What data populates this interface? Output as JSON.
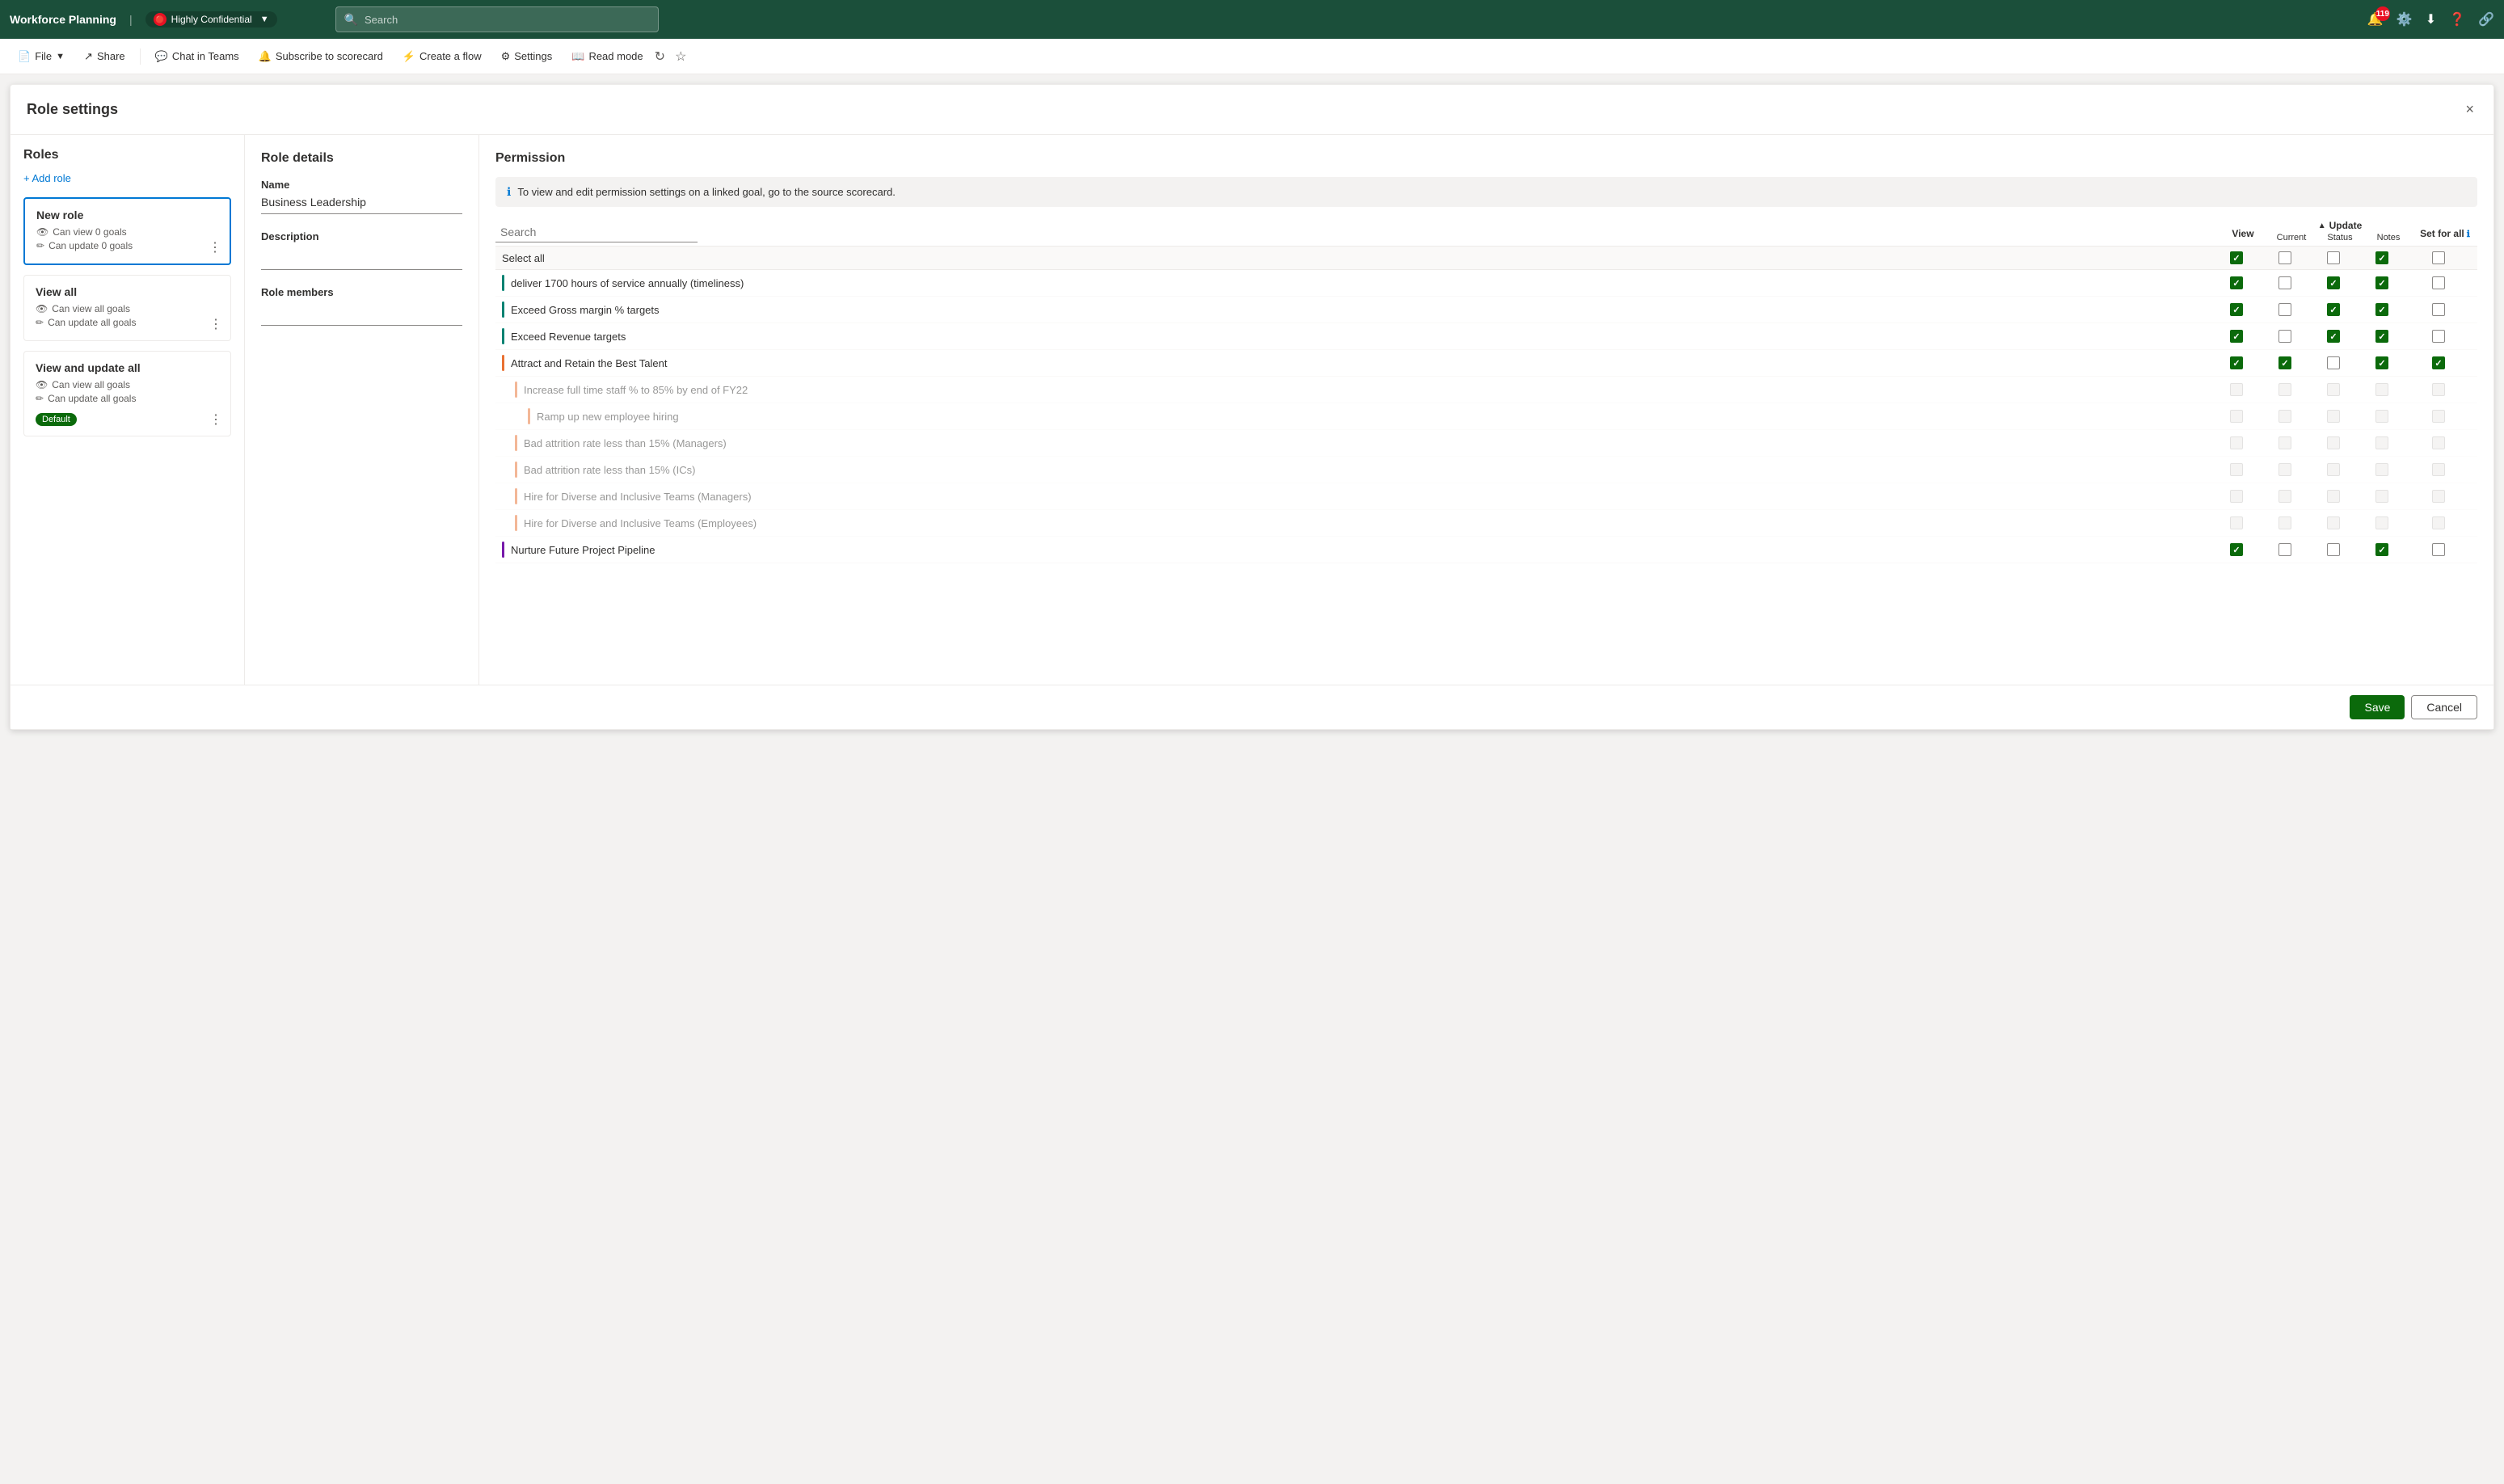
{
  "topbar": {
    "title": "Workforce Planning",
    "divider": "|",
    "confidential_label": "Highly Confidential",
    "search_placeholder": "Search",
    "notification_count": "119",
    "icons": [
      "notification-icon",
      "settings-icon",
      "download-icon",
      "help-icon",
      "apps-icon"
    ]
  },
  "toolbar": {
    "file_label": "File",
    "share_label": "Share",
    "chat_label": "Chat in Teams",
    "subscribe_label": "Subscribe to scorecard",
    "create_flow_label": "Create a flow",
    "settings_label": "Settings",
    "read_mode_label": "Read mode"
  },
  "modal": {
    "title": "Role settings",
    "close_label": "×"
  },
  "roles_panel": {
    "heading": "Roles",
    "add_role_label": "+ Add role",
    "roles": [
      {
        "name": "New role",
        "view_goals": "Can view 0 goals",
        "update_goals": "Can update 0 goals",
        "active": true,
        "default": false
      },
      {
        "name": "View all",
        "view_goals": "Can view all goals",
        "update_goals": "Can update all goals",
        "active": false,
        "default": false
      },
      {
        "name": "View and update all",
        "view_goals": "Can view all goals",
        "update_goals": "Can update all goals",
        "active": false,
        "default": true,
        "default_label": "Default"
      }
    ]
  },
  "role_details": {
    "heading": "Role details",
    "name_label": "Name",
    "name_value": "Business Leadership",
    "description_label": "Description",
    "description_value": "",
    "members_label": "Role members",
    "members_value": ""
  },
  "permission": {
    "heading": "Permission",
    "info_text": "To view and edit permission settings on a linked goal, go to the source scorecard.",
    "search_placeholder": "Search",
    "update_label": "Update",
    "view_label": "View",
    "set_for_all_label": "Set for all",
    "current_label": "Current",
    "status_label": "Status",
    "notes_label": "Notes",
    "select_all_label": "Select all",
    "goals": [
      {
        "name": "deliver 1700 hours of service annually (timeliness)",
        "color": "teal",
        "indent": 0,
        "view": true,
        "current": false,
        "status": true,
        "notes": true,
        "set_all": false,
        "disabled": false
      },
      {
        "name": "Exceed Gross margin % targets",
        "color": "teal",
        "indent": 0,
        "view": true,
        "current": false,
        "status": true,
        "notes": true,
        "set_all": false,
        "disabled": false
      },
      {
        "name": "Exceed Revenue targets",
        "color": "teal",
        "indent": 0,
        "view": true,
        "current": false,
        "status": true,
        "notes": true,
        "set_all": false,
        "disabled": false
      },
      {
        "name": "Attract and Retain the Best Talent",
        "color": "orange",
        "indent": 0,
        "view": true,
        "current": true,
        "status": false,
        "notes": true,
        "set_all": true,
        "disabled": false
      },
      {
        "name": "Increase full time staff % to 85% by end of FY22",
        "color": "orange",
        "indent": 1,
        "view": false,
        "current": false,
        "status": false,
        "notes": false,
        "set_all": false,
        "disabled": true
      },
      {
        "name": "Ramp up new employee hiring",
        "color": "orange",
        "indent": 2,
        "view": false,
        "current": false,
        "status": false,
        "notes": false,
        "set_all": false,
        "disabled": true
      },
      {
        "name": "Bad attrition rate less than 15% (Managers)",
        "color": "orange",
        "indent": 1,
        "view": false,
        "current": false,
        "status": false,
        "notes": false,
        "set_all": false,
        "disabled": true
      },
      {
        "name": "Bad attrition rate less than 15% (ICs)",
        "color": "orange",
        "indent": 1,
        "view": false,
        "current": false,
        "status": false,
        "notes": false,
        "set_all": false,
        "disabled": true
      },
      {
        "name": "Hire for Diverse and Inclusive Teams (Managers)",
        "color": "orange",
        "indent": 1,
        "view": false,
        "current": false,
        "status": false,
        "notes": false,
        "set_all": false,
        "disabled": true
      },
      {
        "name": "Hire for Diverse and Inclusive Teams (Employees)",
        "color": "orange",
        "indent": 1,
        "view": false,
        "current": false,
        "status": false,
        "notes": false,
        "set_all": false,
        "disabled": true
      },
      {
        "name": "Nurture Future Project Pipeline",
        "color": "purple",
        "indent": 0,
        "view": true,
        "current": false,
        "status": false,
        "notes": true,
        "set_all": false,
        "disabled": false
      }
    ],
    "select_all_view": true,
    "select_all_current": false,
    "select_all_status": false,
    "select_all_notes": true,
    "select_all_set": false
  },
  "footer": {
    "save_label": "Save",
    "cancel_label": "Cancel"
  }
}
